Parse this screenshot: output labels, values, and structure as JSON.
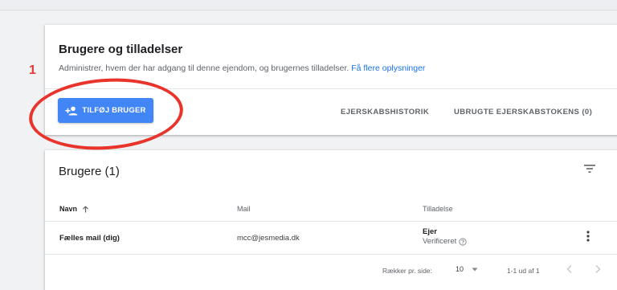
{
  "annotation": {
    "number": "1"
  },
  "permissions_card": {
    "title": "Brugere og tilladelser",
    "description": "Administrer, hvem der har adgang til denne ejendom, og brugernes tilladelser.",
    "link": "Få flere oplysninger",
    "add_user_button": "TILFØJ BRUGER",
    "tabs": [
      "EJERSKABSHISTORIK",
      "UBRUGTE EJERSKABSTOKENS (0)"
    ]
  },
  "users_card": {
    "title": "Brugere (1)",
    "columns": {
      "name": "Navn",
      "mail": "Mail",
      "permission": "Tilladelse"
    },
    "rows": [
      {
        "name": "Fælles mail (dig)",
        "mail": "mcc@jesmedia.dk",
        "role": "Ejer",
        "status": "Verificeret"
      }
    ],
    "pagination": {
      "rows_label": "Rækker pr. side:",
      "rows_value": "10",
      "range": "1-1 ud af 1"
    }
  },
  "colors": {
    "primary": "#4285f4",
    "link": "#1a73e8",
    "annotation": "#e53935"
  }
}
